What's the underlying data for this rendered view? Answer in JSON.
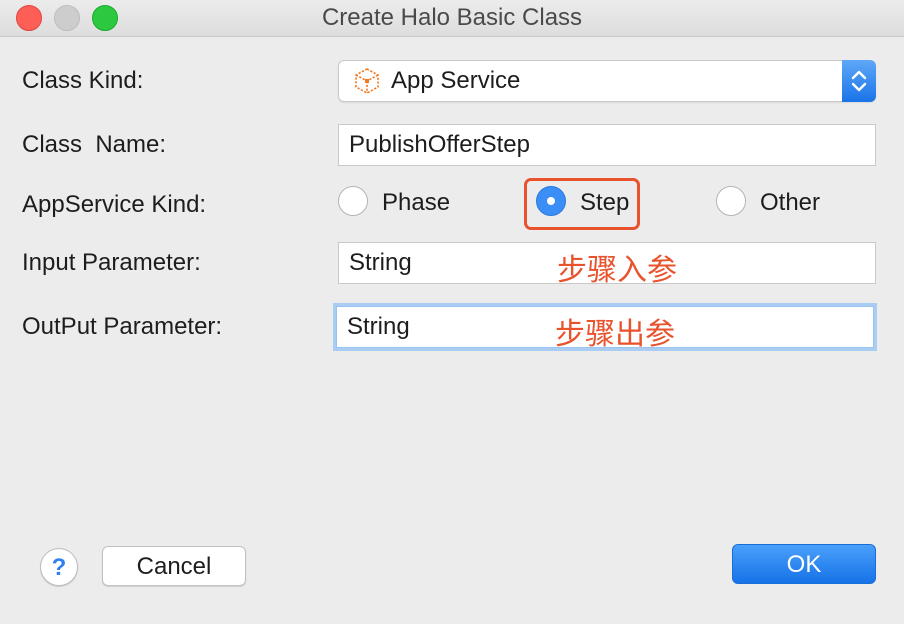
{
  "window": {
    "title": "Create Halo Basic Class"
  },
  "form": {
    "class_kind": {
      "label": "Class Kind:",
      "selected": "App Service",
      "icon": "app-service-icon"
    },
    "class_name": {
      "label": "Class  Name:",
      "value": "PublishOfferStep"
    },
    "appservice_kind": {
      "label": "AppService Kind:",
      "options": [
        "Phase",
        "Step",
        "Other"
      ],
      "selected": "Step"
    },
    "input_parameter": {
      "label": "Input Parameter:",
      "value": "String",
      "annotation": "步骤入参"
    },
    "output_parameter": {
      "label": "OutPut Parameter:",
      "value": "String",
      "annotation": "步骤出参"
    }
  },
  "footer": {
    "help_label": "?",
    "cancel_label": "Cancel",
    "ok_label": "OK"
  },
  "colors": {
    "accent": "#1a73e8",
    "annotation": "#e8522d",
    "app_service_icon": "#f07a22"
  }
}
